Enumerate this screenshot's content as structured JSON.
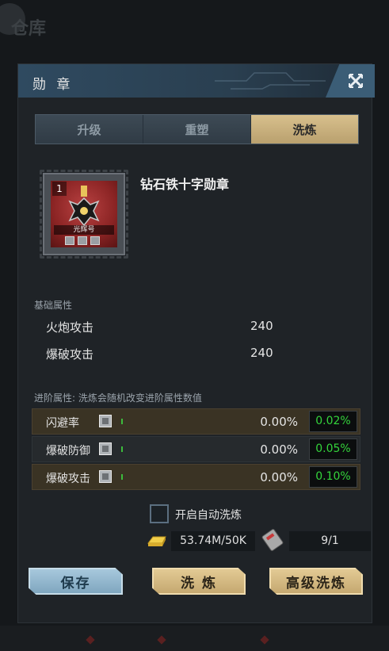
{
  "background": {
    "title": "仓库"
  },
  "modal": {
    "title": "勋 章"
  },
  "tabs": [
    {
      "label": "升级"
    },
    {
      "label": "重塑"
    },
    {
      "label": "洗炼"
    }
  ],
  "medal": {
    "level": "1",
    "name_tag": "光辉号",
    "title": "钻石铁十字勋章"
  },
  "base_stats": {
    "label": "基础属性",
    "rows": [
      {
        "name": "火炮攻击",
        "value": "240"
      },
      {
        "name": "爆破攻击",
        "value": "240"
      }
    ]
  },
  "advanced_stats": {
    "label": "进阶属性:  洗炼会随机改变进阶属性数值",
    "rows": [
      {
        "name": "闪避率",
        "current": "0.00%",
        "new": "0.02%"
      },
      {
        "name": "爆破防御",
        "current": "0.00%",
        "new": "0.05%"
      },
      {
        "name": "爆破攻击",
        "current": "0.00%",
        "new": "0.10%"
      }
    ]
  },
  "auto_refine": {
    "label": "开启自动洗炼",
    "checked": false
  },
  "resources": {
    "gold": "53.74M/50K",
    "tickets": "9/1"
  },
  "buttons": {
    "save": "保存",
    "refine": "洗 炼",
    "advanced_refine": "高级洗炼"
  },
  "colors": {
    "accent_gold": "#d8c08d",
    "accent_blue": "#a7c8dc",
    "new_value_green": "#34d43b"
  }
}
